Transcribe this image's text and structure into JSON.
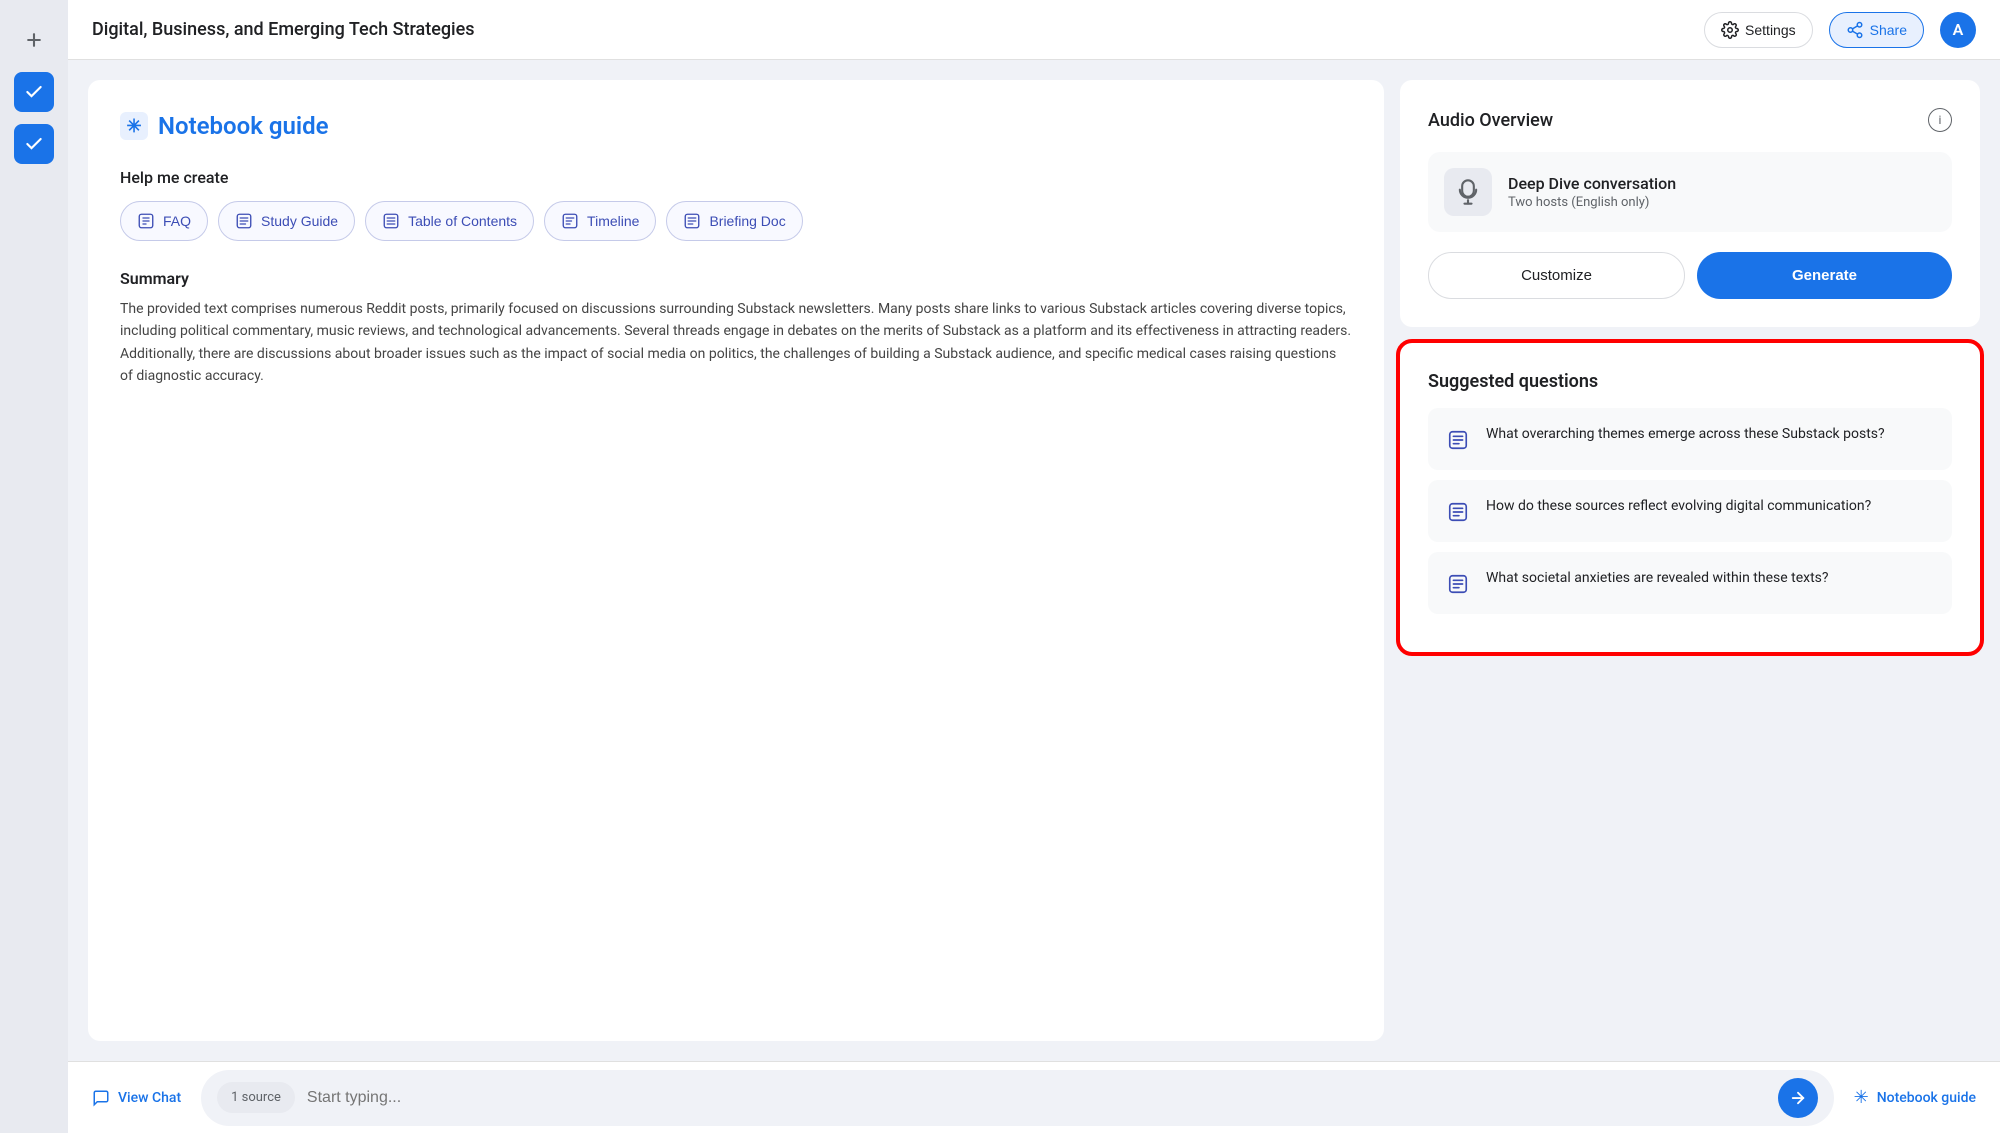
{
  "header": {
    "title": "Digital, Business, and Emerging Tech Strategies",
    "settings_label": "Settings",
    "share_label": "Share",
    "avatar_label": "A"
  },
  "sidebar": {
    "icons": [
      {
        "name": "add-icon",
        "symbol": "+",
        "active": false
      },
      {
        "name": "check-icon-1",
        "symbol": "✓",
        "active": true
      },
      {
        "name": "check-icon-2",
        "symbol": "✓",
        "active": true
      }
    ]
  },
  "guide": {
    "title": "Notebook guide",
    "help_me_create_label": "Help me create",
    "buttons": [
      {
        "id": "faq",
        "label": "FAQ"
      },
      {
        "id": "study-guide",
        "label": "Study Guide"
      },
      {
        "id": "table-of-contents",
        "label": "Table of Contents"
      },
      {
        "id": "timeline",
        "label": "Timeline"
      },
      {
        "id": "briefing-doc",
        "label": "Briefing Doc"
      }
    ],
    "summary": {
      "title": "Summary",
      "text": "The provided text comprises numerous Reddit posts, primarily focused on discussions surrounding Substack newsletters. Many posts share links to various Substack articles covering diverse topics, including political commentary, music reviews, and technological advancements. Several threads engage in debates on the merits of Substack as a platform and its effectiveness in attracting readers. Additionally, there are discussions about broader issues such as the impact of social media on politics, the challenges of building a Substack audience, and specific medical cases raising questions of diagnostic accuracy."
    }
  },
  "audio": {
    "title": "Audio Overview",
    "deep_dive_name": "Deep Dive conversation",
    "deep_dive_sub": "Two hosts (English only)",
    "customize_label": "Customize",
    "generate_label": "Generate"
  },
  "suggested": {
    "title": "Suggested questions",
    "questions": [
      "What overarching themes emerge across these Substack posts?",
      "How do these sources reflect evolving digital communication?",
      "What societal anxieties are revealed within these texts?"
    ]
  },
  "bottom": {
    "view_chat_label": "View Chat",
    "source_label": "1 source",
    "input_placeholder": "Start typing...",
    "notebook_guide_label": "Notebook guide"
  }
}
